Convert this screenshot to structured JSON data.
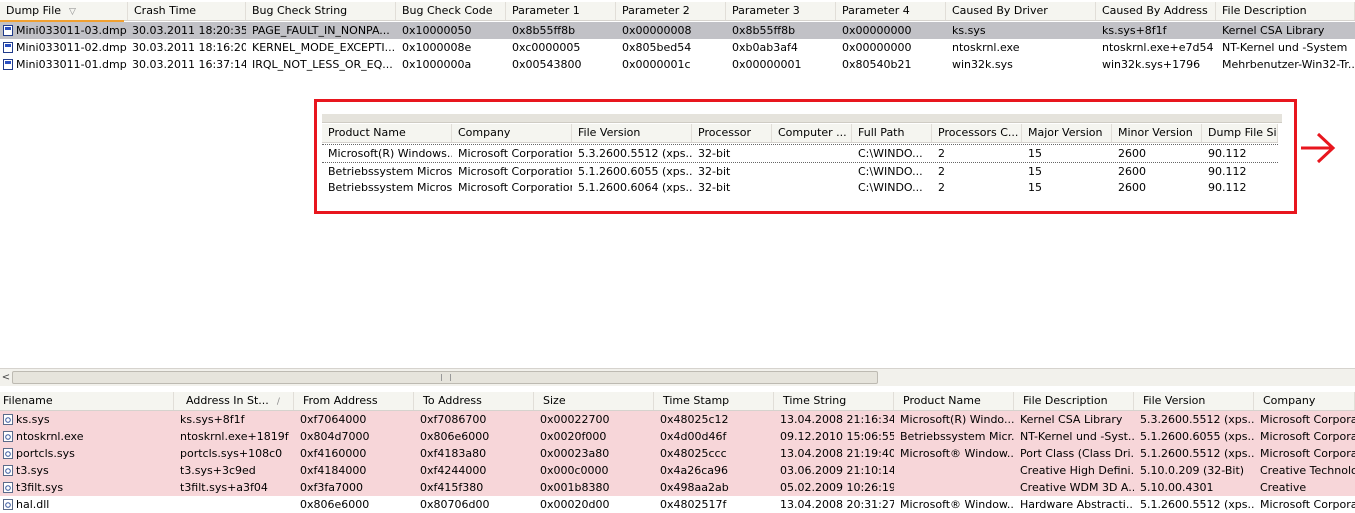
{
  "top_table": {
    "columns": [
      "Dump File",
      "Crash Time",
      "Bug Check String",
      "Bug Check Code",
      "Parameter 1",
      "Parameter 2",
      "Parameter 3",
      "Parameter 4",
      "Caused By Driver",
      "Caused By Address",
      "File Description"
    ],
    "rows": [
      [
        "Mini033011-03.dmp",
        "30.03.2011 18:20:35",
        "PAGE_FAULT_IN_NONPA...",
        "0x10000050",
        "0x8b55ff8b",
        "0x00000008",
        "0x8b55ff8b",
        "0x00000000",
        "ks.sys",
        "ks.sys+8f1f",
        "Kernel CSA Library"
      ],
      [
        "Mini033011-02.dmp",
        "30.03.2011 18:16:20",
        "KERNEL_MODE_EXCEPTI...",
        "0x1000008e",
        "0xc0000005",
        "0x805bed54",
        "0xb0ab3af4",
        "0x00000000",
        "ntoskrnl.exe",
        "ntoskrnl.exe+e7d54",
        "NT-Kernel und -System"
      ],
      [
        "Mini033011-01.dmp",
        "30.03.2011 16:37:14",
        "IRQL_NOT_LESS_OR_EQ...",
        "0x1000000a",
        "0x00543800",
        "0x0000001c",
        "0x00000001",
        "0x80540b21",
        "win32k.sys",
        "win32k.sys+1796",
        "Mehrbenutzer-Win32-Tr..."
      ]
    ]
  },
  "overlay_table": {
    "columns": [
      "Product Name",
      "Company",
      "File Version",
      "Processor",
      "Computer ...",
      "Full Path",
      "Processors C...",
      "Major Version",
      "Minor Version",
      "Dump File Size"
    ],
    "rows": [
      [
        "Microsoft(R) Windows...",
        "Microsoft Corporation",
        "5.3.2600.5512 (xps...",
        "32-bit",
        "",
        "C:\\WINDO...",
        "2",
        "15",
        "2600",
        "90.112"
      ],
      [
        "Betriebssystem Micros...",
        "Microsoft Corporation",
        "5.1.2600.6055 (xps...",
        "32-bit",
        "",
        "C:\\WINDO...",
        "2",
        "15",
        "2600",
        "90.112"
      ],
      [
        "Betriebssystem Micros...",
        "Microsoft Corporation",
        "5.1.2600.6064 (xps...",
        "32-bit",
        "",
        "C:\\WINDO...",
        "2",
        "15",
        "2600",
        "90.112"
      ]
    ]
  },
  "bottom_table": {
    "columns": [
      "Filename",
      "Address In St...",
      "From Address",
      "To Address",
      "Size",
      "Time Stamp",
      "Time String",
      "Product Name",
      "File Description",
      "File Version",
      "Company"
    ],
    "rows": [
      [
        "ks.sys",
        "ks.sys+8f1f",
        "0xf7064000",
        "0xf7086700",
        "0x00022700",
        "0x48025c12",
        "13.04.2008 21:16:34",
        "Microsoft(R) Windo...",
        "Kernel CSA Library",
        "5.3.2600.5512 (xps...",
        "Microsoft Corporatio"
      ],
      [
        "ntoskrnl.exe",
        "ntoskrnl.exe+1819f",
        "0x804d7000",
        "0x806e6000",
        "0x0020f000",
        "0x4d00d46f",
        "09.12.2010 15:06:55",
        "Betriebssystem Micr...",
        "NT-Kernel und -Syst...",
        "5.1.2600.6055 (xps...",
        "Microsoft Corporatio"
      ],
      [
        "portcls.sys",
        "portcls.sys+108c0",
        "0xf4160000",
        "0xf4183a80",
        "0x00023a80",
        "0x48025ccc",
        "13.04.2008 21:19:40",
        "Microsoft® Window...",
        "Port Class (Class Dri...",
        "5.1.2600.5512 (xps...",
        "Microsoft Corporatio"
      ],
      [
        "t3.sys",
        "t3.sys+3c9ed",
        "0xf4184000",
        "0xf4244000",
        "0x000c0000",
        "0x4a26ca96",
        "03.06.2009 21:10:14",
        "",
        "Creative High Defini...",
        "5.10.0.209 (32-Bit)",
        "Creative Technolog"
      ],
      [
        "t3filt.sys",
        "t3filt.sys+a3f04",
        "0xf3fa7000",
        "0xf415f380",
        "0x001b8380",
        "0x498aa2ab",
        "05.02.2009 10:26:19",
        "",
        "Creative WDM 3D A...",
        "5.10.00.4301",
        "Creative"
      ],
      [
        "hal.dll",
        "",
        "0x806e6000",
        "0x80706d00",
        "0x00020d00",
        "0x4802517f",
        "13.04.2008 20:31:27",
        "Microsoft® Window...",
        "Hardware Abstracti...",
        "5.1.2600.5512 (xps...",
        "Microsoft Corporatio"
      ]
    ]
  },
  "colors": {
    "highlight_box": "#e8161e",
    "selected_row": "#c1c1c6",
    "pink_row": "#f7d6d9"
  },
  "icons": {
    "dump_file": "file-dump-icon",
    "module": "module-icon",
    "arrow": "arrow-right-icon"
  }
}
